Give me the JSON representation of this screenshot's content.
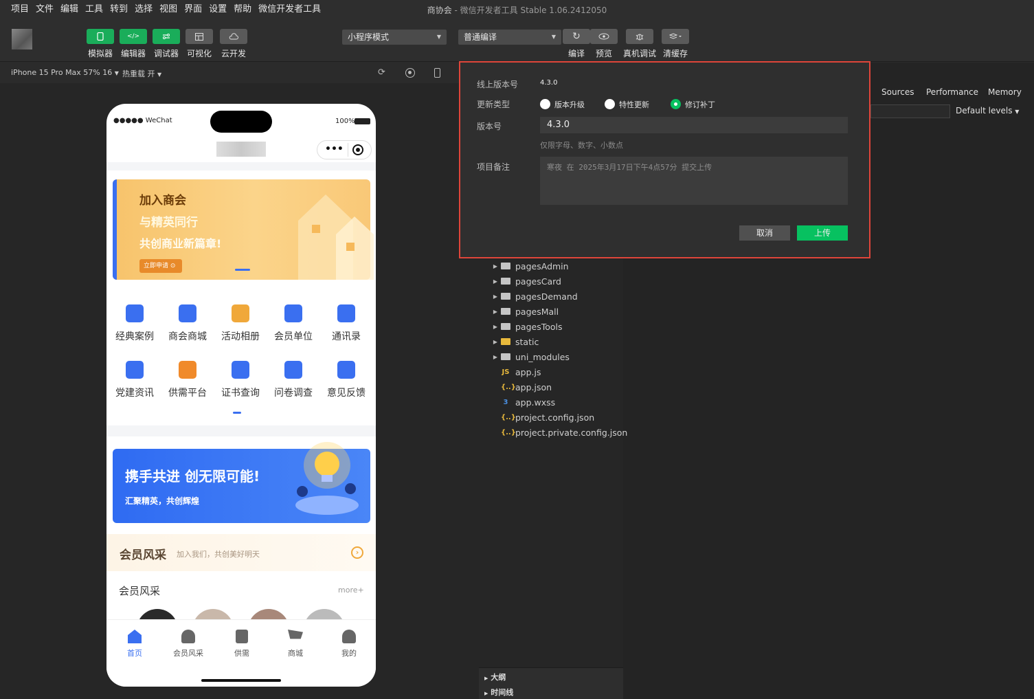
{
  "menubar": {
    "items": [
      "项目",
      "文件",
      "编辑",
      "工具",
      "转到",
      "选择",
      "视图",
      "界面",
      "设置",
      "帮助",
      "微信开发者工具"
    ],
    "title_app": "商协会",
    "title_sep": " - ",
    "title_tool": "微信开发者工具 Stable 1.06.2412050"
  },
  "toolbar": {
    "left_buttons": [
      "模拟器",
      "编辑器",
      "调试器",
      "可视化",
      "云开发"
    ],
    "mode_select": "小程序模式",
    "compile_select": "普通编译",
    "right_buttons": [
      "编译",
      "预览",
      "真机调试",
      "清缓存"
    ]
  },
  "simbar": {
    "device": "iPhone 15 Pro Max 57% 16",
    "hotreload": "热重载 开"
  },
  "phone": {
    "carrier": "●●●●● WeChat",
    "battery": "100%",
    "banner1": {
      "line1": "加入商会",
      "line2": "与精英同行",
      "line3": "共创商业新篇章!",
      "cta": "立即申请"
    },
    "grid": [
      {
        "label": "经典案例",
        "icon": "case-icon",
        "color": "#3a6ff0"
      },
      {
        "label": "商会商城",
        "icon": "shop-bag-icon",
        "color": "#3a6ff0"
      },
      {
        "label": "活动相册",
        "icon": "album-icon",
        "color": "#f0a83a"
      },
      {
        "label": "会员单位",
        "icon": "members-icon",
        "color": "#3a6ff0"
      },
      {
        "label": "通讯录",
        "icon": "contacts-icon",
        "color": "#3a6ff0"
      },
      {
        "label": "党建资讯",
        "icon": "news-icon",
        "color": "#3a6ff0"
      },
      {
        "label": "供需平台",
        "icon": "handshake-icon",
        "color": "#f08a2a"
      },
      {
        "label": "证书查询",
        "icon": "certificate-icon",
        "color": "#3a6ff0"
      },
      {
        "label": "问卷调查",
        "icon": "survey-icon",
        "color": "#3a6ff0"
      },
      {
        "label": "意见反馈",
        "icon": "feedback-icon",
        "color": "#3a6ff0"
      }
    ],
    "banner2": {
      "title": "携手共进 创无限可能!",
      "subtitle": "汇聚精英，共创辉煌"
    },
    "promo": {
      "title": "会员风采",
      "subtitle": "加入我们，共创美好明天"
    },
    "section": {
      "title": "会员风采",
      "more": "more+"
    },
    "tabs": [
      "首页",
      "会员风采",
      "供需",
      "商城",
      "我的"
    ]
  },
  "devtools": {
    "tabs": [
      "Sources",
      "Performance",
      "Memory"
    ],
    "levels": "Default levels"
  },
  "tree": {
    "folders": [
      "pagesAdmin",
      "pagesCard",
      "pagesDemand",
      "pagesMall",
      "pagesTools",
      "static",
      "uni_modules"
    ],
    "files": [
      {
        "name": "app.js",
        "icon": "JS",
        "color": "#e8b93c"
      },
      {
        "name": "app.json",
        "icon": "{..}",
        "color": "#e8b93c"
      },
      {
        "name": "app.wxss",
        "icon": "3",
        "color": "#4a8fe0"
      },
      {
        "name": "project.config.json",
        "icon": "{..}",
        "color": "#e8b93c"
      },
      {
        "name": "project.private.config.json",
        "icon": "{..}",
        "color": "#e8b93c"
      }
    ],
    "bottom": [
      "大纲",
      "时间线"
    ]
  },
  "dialog": {
    "online_label": "线上版本号",
    "online_value": "4.3.0",
    "type_label": "更新类型",
    "options": [
      "版本升级",
      "特性更新",
      "修订补丁"
    ],
    "selected": 2,
    "version_label": "版本号",
    "version_value": "4.3.0",
    "version_hint": "仅限字母、数字、小数点",
    "note_label": "项目备注",
    "note_placeholder": "寒夜 在 2025年3月17日下午4点57分 提交上传",
    "cancel": "取消",
    "upload": "上传",
    "border_color": "#e0453a",
    "accent": "#07c160"
  }
}
